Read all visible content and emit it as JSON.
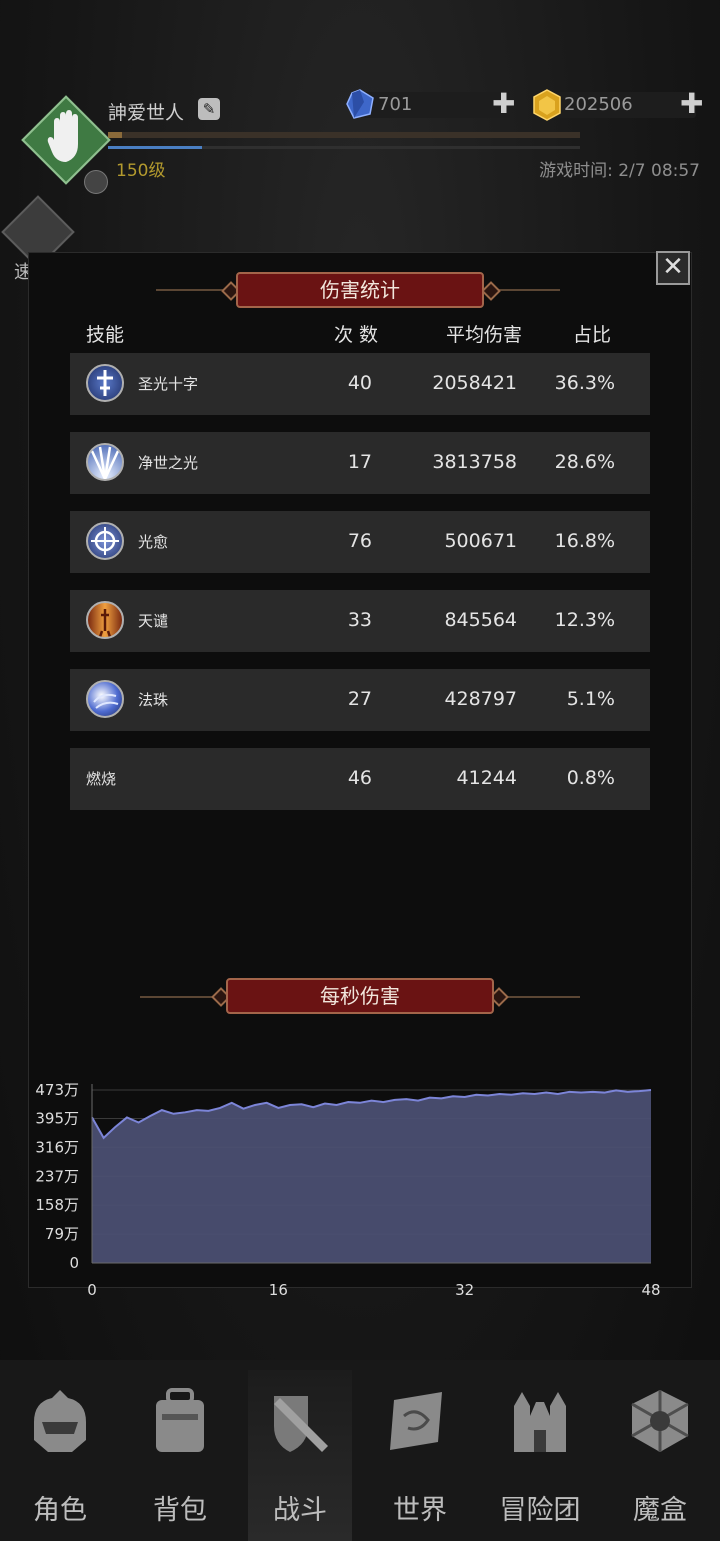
{
  "header": {
    "player_name": "訷爱世人",
    "level": "150级",
    "avatar_badge": "",
    "game_time": "游戏时间: 2/7 08:57",
    "xp_fraction": 0.03,
    "energy_fraction": 0.2,
    "resources": [
      {
        "name": "blue-gem",
        "value": "701"
      },
      {
        "name": "gold-gem",
        "value": "202506"
      }
    ],
    "plus": "✚",
    "speed_label": "速 战"
  },
  "dialog": {
    "close": "✕",
    "title": "伤害统计",
    "columns": {
      "skill": "技能",
      "count": "次 数",
      "avg": "平均伤害",
      "ratio": "占比"
    },
    "rows": [
      {
        "icon": "holy-cross-icon",
        "name": "圣光十字",
        "count": "40",
        "avg": "2058421",
        "ratio": "36.3%"
      },
      {
        "icon": "purifying-light-icon",
        "name": "净世之光",
        "count": "17",
        "avg": "3813758",
        "ratio": "28.6%"
      },
      {
        "icon": "heal-light-icon",
        "name": "光愈",
        "count": "76",
        "avg": "500671",
        "ratio": "16.8%"
      },
      {
        "icon": "divine-punishment-icon",
        "name": "天谴",
        "count": "33",
        "avg": "845564",
        "ratio": "12.3%"
      },
      {
        "icon": "orb-icon",
        "name": "法珠",
        "count": "27",
        "avg": "428797",
        "ratio": "5.1%"
      },
      {
        "icon": "",
        "name": "燃烧",
        "count": "46",
        "avg": "41244",
        "ratio": "0.8%"
      }
    ],
    "dps_title": "每秒伤害"
  },
  "chart_data": {
    "type": "area",
    "title": "每秒伤害",
    "xlabel": "",
    "ylabel": "",
    "x_ticks": [
      "0",
      "16",
      "32",
      "48"
    ],
    "y_ticks": [
      "0",
      "79万",
      "158万",
      "237万",
      "316万",
      "395万",
      "473万"
    ],
    "xlim": [
      0,
      48
    ],
    "ylim": [
      0,
      473
    ],
    "y_unit": "万",
    "x": [
      0,
      1,
      2,
      3,
      4,
      5,
      6,
      7,
      8,
      9,
      10,
      11,
      12,
      13,
      14,
      15,
      16,
      17,
      18,
      19,
      20,
      21,
      22,
      23,
      24,
      25,
      26,
      27,
      28,
      29,
      30,
      31,
      32,
      33,
      34,
      35,
      36,
      37,
      38,
      39,
      40,
      41,
      42,
      43,
      44,
      45,
      46,
      47,
      48
    ],
    "values": [
      398,
      342,
      372,
      398,
      384,
      402,
      418,
      408,
      412,
      418,
      416,
      424,
      438,
      422,
      432,
      438,
      424,
      432,
      434,
      426,
      436,
      432,
      440,
      438,
      444,
      440,
      446,
      448,
      444,
      452,
      450,
      456,
      454,
      460,
      458,
      462,
      460,
      464,
      462,
      466,
      462,
      468,
      466,
      468,
      466,
      472,
      468,
      470,
      473
    ],
    "fill_color": "#4b4f72",
    "line_color": "#7c85d8",
    "grid": true
  },
  "nav": [
    {
      "id": "character",
      "label": "角色"
    },
    {
      "id": "bag",
      "label": "背包"
    },
    {
      "id": "battle",
      "label": "战斗"
    },
    {
      "id": "world",
      "label": "世界"
    },
    {
      "id": "guild",
      "label": "冒险团"
    },
    {
      "id": "magic-box",
      "label": "魔盒"
    }
  ]
}
